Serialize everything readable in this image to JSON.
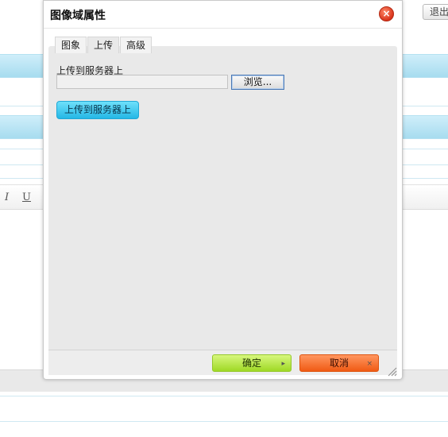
{
  "background": {
    "logout_label": "退出",
    "toolbar_italic": "I",
    "toolbar_underline": "U"
  },
  "dialog": {
    "title": "图像域属性",
    "close_symbol": "×",
    "tabs": [
      {
        "label": "图象",
        "active": false
      },
      {
        "label": "上传",
        "active": true
      },
      {
        "label": "高级",
        "active": false
      }
    ],
    "upload": {
      "label": "上传到服务器上",
      "file_value": "",
      "browse_label": "浏览...",
      "submit_label": "上传到服务器上"
    },
    "ok_label": "确定",
    "cancel_label": "取消",
    "ok_icon": "arrow-right-icon",
    "cancel_icon": "close-icon"
  },
  "colors": {
    "ok_button": "#9fd925",
    "cancel_button": "#f05a14",
    "upload_button": "#24b7e6",
    "close_button": "#d9341b"
  }
}
